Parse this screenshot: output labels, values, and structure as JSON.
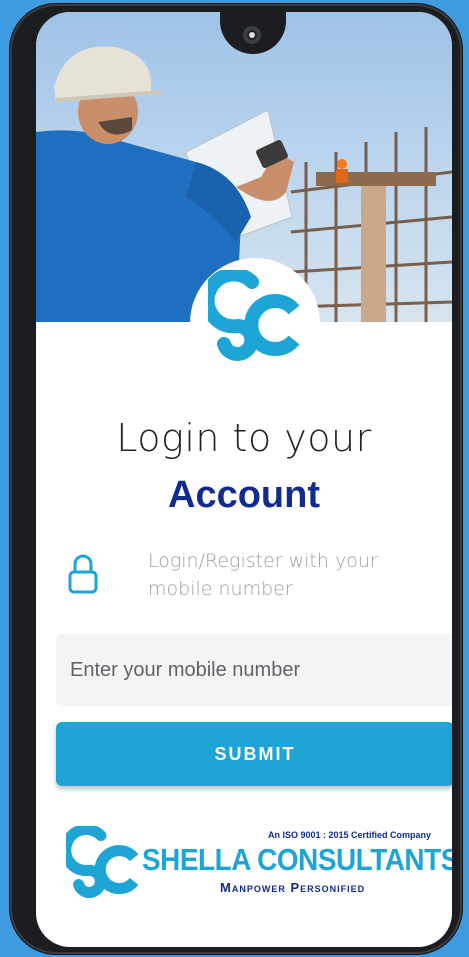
{
  "login": {
    "title_line1": "Login to your",
    "title_line2": "Account",
    "hint": "Login/Register with your mobile number",
    "mobile_placeholder": "Enter your mobile number",
    "submit_label": "SUBMIT"
  },
  "brand": {
    "logo_letters": "SC",
    "certification": "An ISO 9001 : 2015 Certified Company",
    "name": "SHELLA CONSULTANTS",
    "tagline": "Manpower Personified"
  },
  "hero": {
    "description_icon": "construction-worker-photo"
  },
  "icons": {
    "lock": "lock-icon",
    "logo": "sc-logo-icon"
  },
  "colors": {
    "primary": "#1da5d6",
    "navy": "#122b8c",
    "background": "#3f9be0"
  }
}
